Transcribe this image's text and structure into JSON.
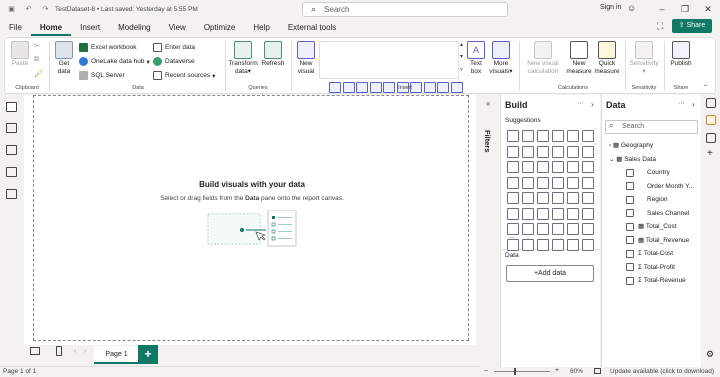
{
  "titlebar": {
    "title": "TestDataset-8 • Last saved: Yesterday at 5:55 PM",
    "search_placeholder": "Search",
    "signin": "Sign in"
  },
  "menu": {
    "items": [
      "File",
      "Home",
      "Insert",
      "Modeling",
      "View",
      "Optimize",
      "Help",
      "External tools"
    ],
    "share": "Share"
  },
  "ribbon": {
    "clipboard": {
      "paste": "Paste",
      "label": "Clipboard"
    },
    "data": {
      "get_data": "Get",
      "get_data_2": "data",
      "excel": "Excel workbook",
      "onelake": "OneLake data hub",
      "sql": "SQL Server",
      "enter": "Enter data",
      "dataverse": "Dataverse",
      "recent": "Recent sources",
      "label": "Data"
    },
    "queries": {
      "transform": "Transform",
      "transform_2": "data",
      "refresh": "Refresh",
      "label": "Queries"
    },
    "insert": {
      "new_visual": "New",
      "new_visual_2": "visual",
      "text_box": "Text",
      "text_box_2": "box",
      "more_visuals": "More",
      "more_visuals_2": "visuals",
      "label": "Insert"
    },
    "calculations": {
      "new_visual_calc": "New visual",
      "new_visual_calc_2": "calculation",
      "new_measure": "New",
      "new_measure_2": "measure",
      "quick_measure": "Quick",
      "quick_measure_2": "measure",
      "label": "Calculations"
    },
    "sensitivity": {
      "btn": "Sensitivity",
      "label": "Sensitivity"
    },
    "share": {
      "publish": "Publish",
      "label": "Share"
    }
  },
  "canvas": {
    "title": "Build visuals with your data",
    "subtitle_pre": "Select or drag fields from the ",
    "subtitle_bold": "Data",
    "subtitle_post": " pane onto the report canvas."
  },
  "pages": {
    "page1": "Page 1",
    "add": "+"
  },
  "status": {
    "page": "Page 1 of 1",
    "zoom": "60%",
    "update": "Update available (click to download)"
  },
  "filters": {
    "label": "Filters"
  },
  "build": {
    "title": "Build",
    "suggestions": "Suggestions",
    "more": "...",
    "data_label": "Data",
    "add_data": "+Add data"
  },
  "data_pane": {
    "title": "Data",
    "search_placeholder": "Search",
    "tables": [
      {
        "name": "Geography",
        "expanded": false
      },
      {
        "name": "Sales Data",
        "expanded": true
      }
    ],
    "fields": [
      {
        "name": "Country",
        "type": "text"
      },
      {
        "name": "Order Month Y...",
        "type": "text"
      },
      {
        "name": "Region",
        "type": "text"
      },
      {
        "name": "Sales Channel",
        "type": "text"
      },
      {
        "name": "Total_Cost",
        "type": "table"
      },
      {
        "name": "Total_Revenue",
        "type": "table"
      },
      {
        "name": "Total-Cost",
        "type": "sigma"
      },
      {
        "name": "Total-Profit",
        "type": "sigma"
      },
      {
        "name": "Total-Revenue",
        "type": "sigma"
      }
    ]
  },
  "colors": {
    "accent": "#117865",
    "visual": "#5b5fc7"
  }
}
